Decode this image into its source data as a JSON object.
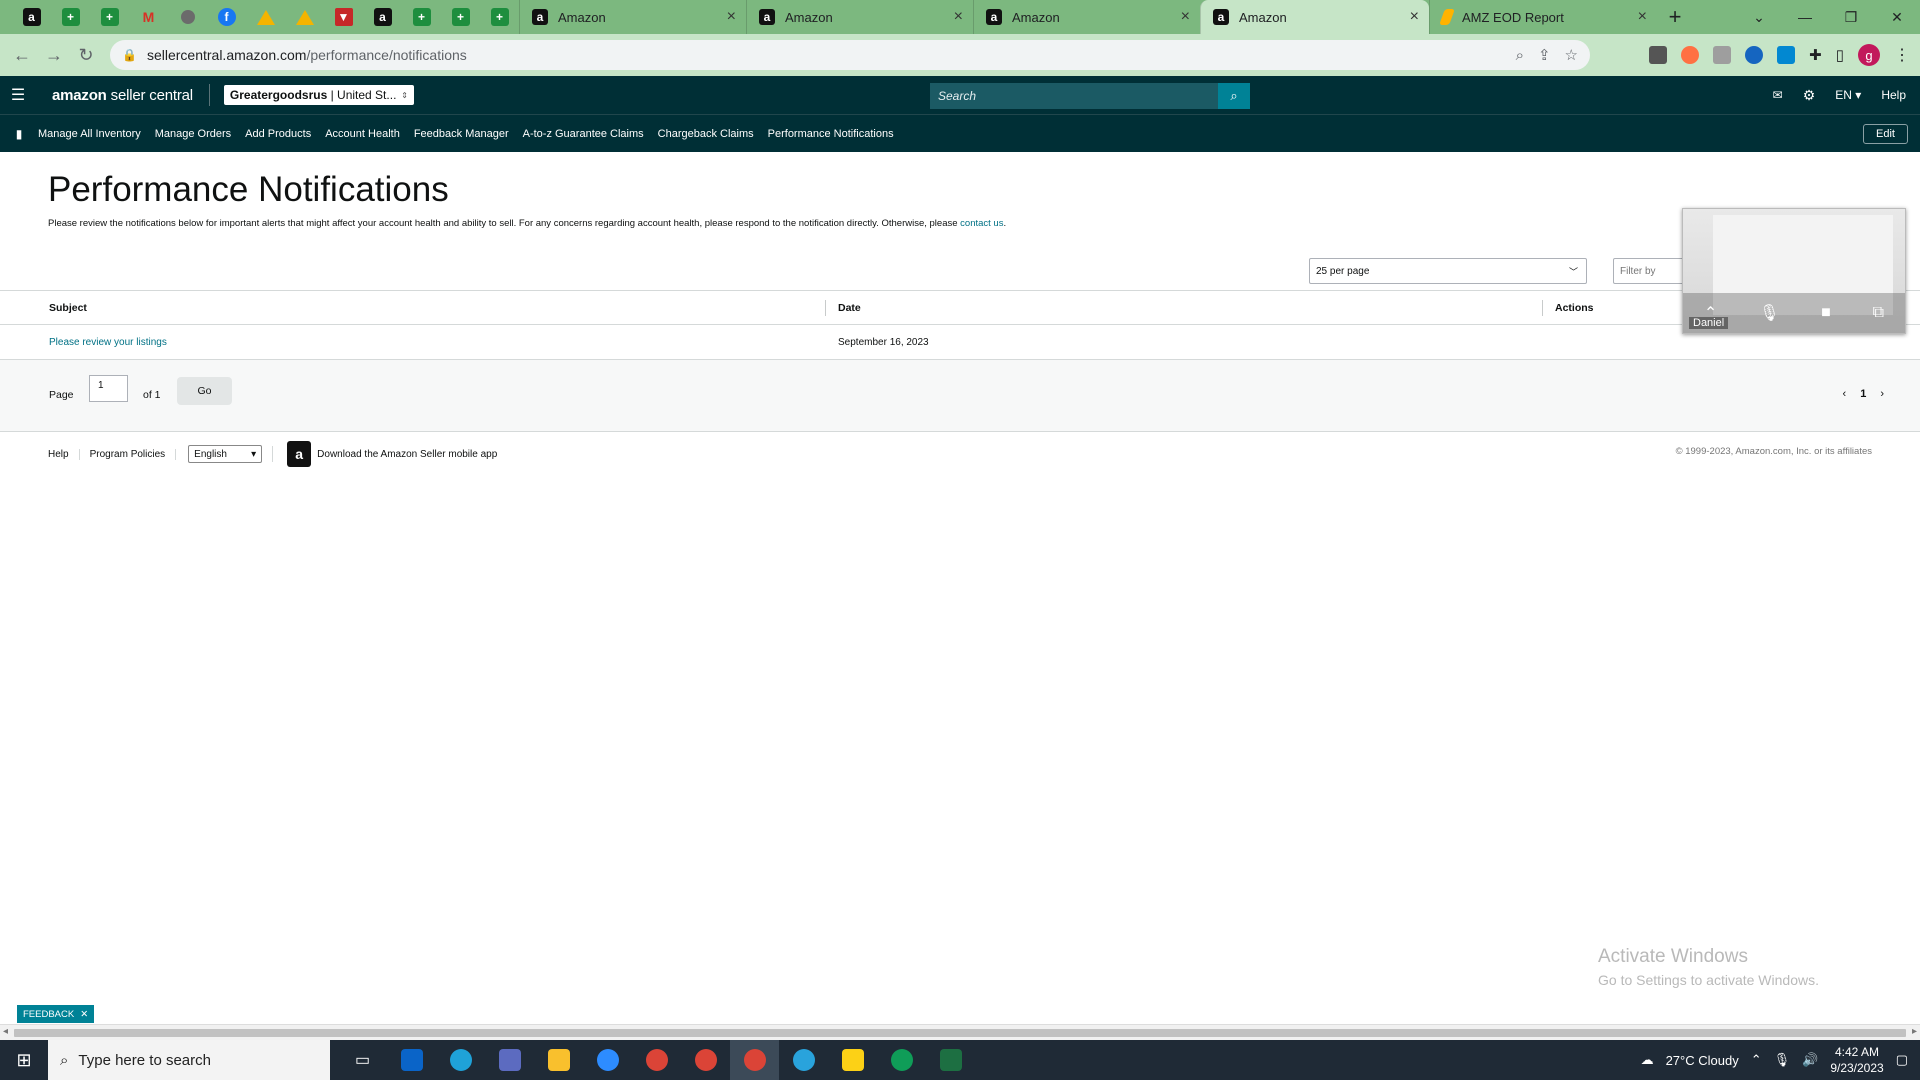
{
  "browser": {
    "tabs": [
      {
        "title": "Amazon",
        "active": false
      },
      {
        "title": "Amazon",
        "active": false
      },
      {
        "title": "Amazon",
        "active": false
      },
      {
        "title": "Amazon",
        "active": true
      },
      {
        "title": "AMZ EOD Report",
        "active": false
      }
    ],
    "url_host": "sellercentral.amazon.com",
    "url_path": "/performance/notifications",
    "profile_initial": "g"
  },
  "header": {
    "logo_bold": "amazon",
    "logo_rest": "seller central",
    "store_name": "Greatergoodsrus",
    "store_region": " | United St...",
    "search_placeholder": "Search",
    "language": "EN",
    "help": "Help"
  },
  "nav": {
    "items": [
      "Manage All Inventory",
      "Manage Orders",
      "Add Products",
      "Account Health",
      "Feedback Manager",
      "A-to-z Guarantee Claims",
      "Chargeback Claims",
      "Performance Notifications"
    ],
    "edit": "Edit"
  },
  "page": {
    "title": "Performance Notifications",
    "intro": "Please review the notifications below for important alerts that might affect your account health and ability to sell. For any concerns regarding account health, please respond to the notification directly. Otherwise, please ",
    "contact_link": "contact us",
    "per_page": "25 per page",
    "filter_placeholder": "Filter by"
  },
  "table": {
    "columns": [
      "Subject",
      "Date",
      "Actions"
    ],
    "rows": [
      {
        "subject": "Please review your listings",
        "date": "September 16, 2023"
      }
    ]
  },
  "pager": {
    "page_label": "Page",
    "page_value": "1",
    "of_label": "of 1",
    "go": "Go",
    "current": "1"
  },
  "footer": {
    "help": "Help",
    "policies": "Program Policies",
    "language": "English",
    "app_text": "Download the Amazon Seller mobile app",
    "copyright": "© 1999-2023, Amazon.com, Inc. or its affiliates"
  },
  "video": {
    "participant": "Daniel"
  },
  "watermark": {
    "line1": "Activate Windows",
    "line2": "Go to Settings to activate Windows."
  },
  "feedback": "FEEDBACK",
  "taskbar": {
    "search_placeholder": "Type here to search",
    "weather": "27°C  Cloudy",
    "time": "4:42 AM",
    "date": "9/23/2023"
  }
}
